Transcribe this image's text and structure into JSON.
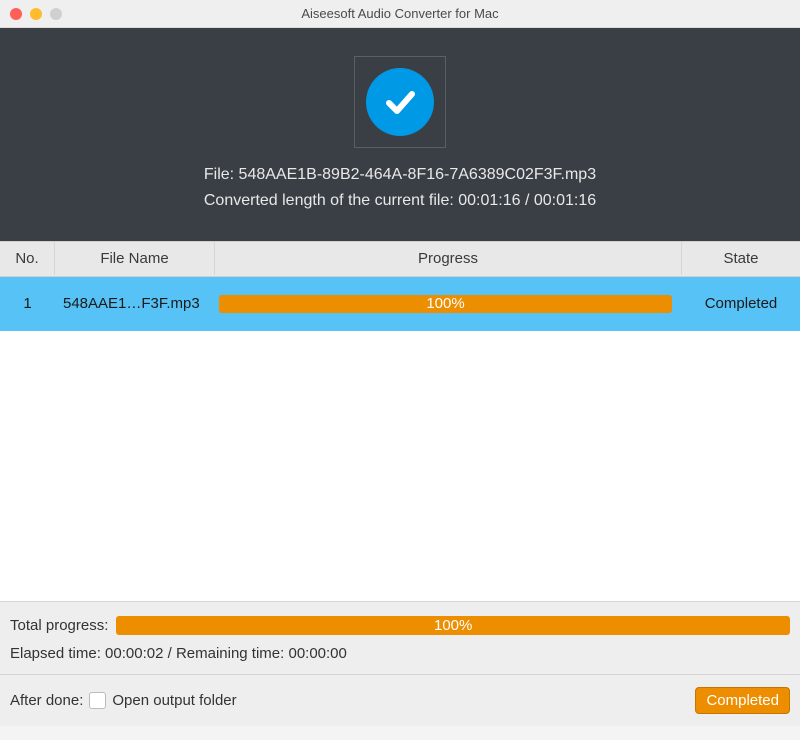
{
  "window": {
    "title": "Aiseesoft Audio Converter for Mac"
  },
  "hero": {
    "file_label": "File: 548AAE1B-89B2-464A-8F16-7A6389C02F3F.mp3",
    "converted_label": "Converted length of the current file: 00:01:16 / 00:01:16"
  },
  "columns": {
    "no": "No.",
    "name": "File Name",
    "progress": "Progress",
    "state": "State"
  },
  "rows": [
    {
      "no": "1",
      "name": "548AAE1…F3F.mp3",
      "progress_percent": "100%",
      "state": "Completed"
    }
  ],
  "footer": {
    "total_label": "Total progress:",
    "total_percent": "100%",
    "elapsed_remaining": "Elapsed time: 00:00:02 / Remaining time: 00:00:00",
    "after_done_label": "After done:",
    "open_output_label": "Open output folder",
    "button_label": "Completed"
  }
}
